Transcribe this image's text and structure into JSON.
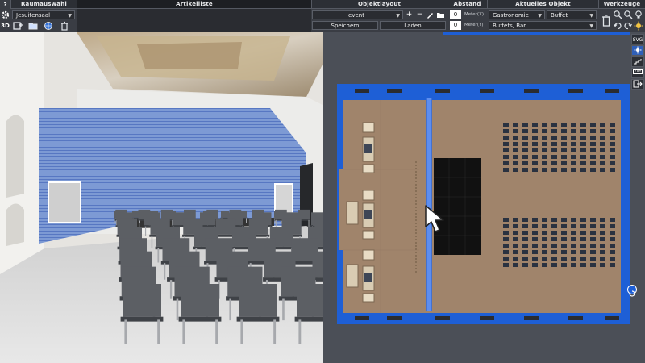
{
  "toolbar": {
    "help_label": "?",
    "raumauswahl": {
      "title": "Raumauswahl",
      "room_value": "Jesuitensaal"
    },
    "artikelliste": {
      "title": "Artikelliste"
    },
    "objektlayout": {
      "title": "Objektlayout",
      "layout_value": "event",
      "save_label": "Speichern",
      "load_label": "Laden"
    },
    "abstand": {
      "title": "Abstand",
      "x_value": "0",
      "x_unit": "Meter(X)",
      "y_value": "0",
      "y_unit": "Meter(Y)"
    },
    "aktuelles_objekt": {
      "title": "Aktuelles Objekt",
      "category": "Gastronomie",
      "type": "Buffet",
      "subtype": "Buffets, Bar"
    },
    "werkzeuge": {
      "title": "Werkzeuge"
    }
  },
  "left_tools": {
    "view3d_label": "3D",
    "view2d_label": "2D"
  },
  "right_tools": {
    "svg_label": "SVG"
  },
  "colors": {
    "toolbar_bg": "#3a3d44",
    "accent_blue": "#1e5fd6",
    "plan_floor": "#a0846b",
    "plan_bg": "#4b4f57",
    "chair_dark": "#2a3240",
    "stage_black": "#111111"
  }
}
